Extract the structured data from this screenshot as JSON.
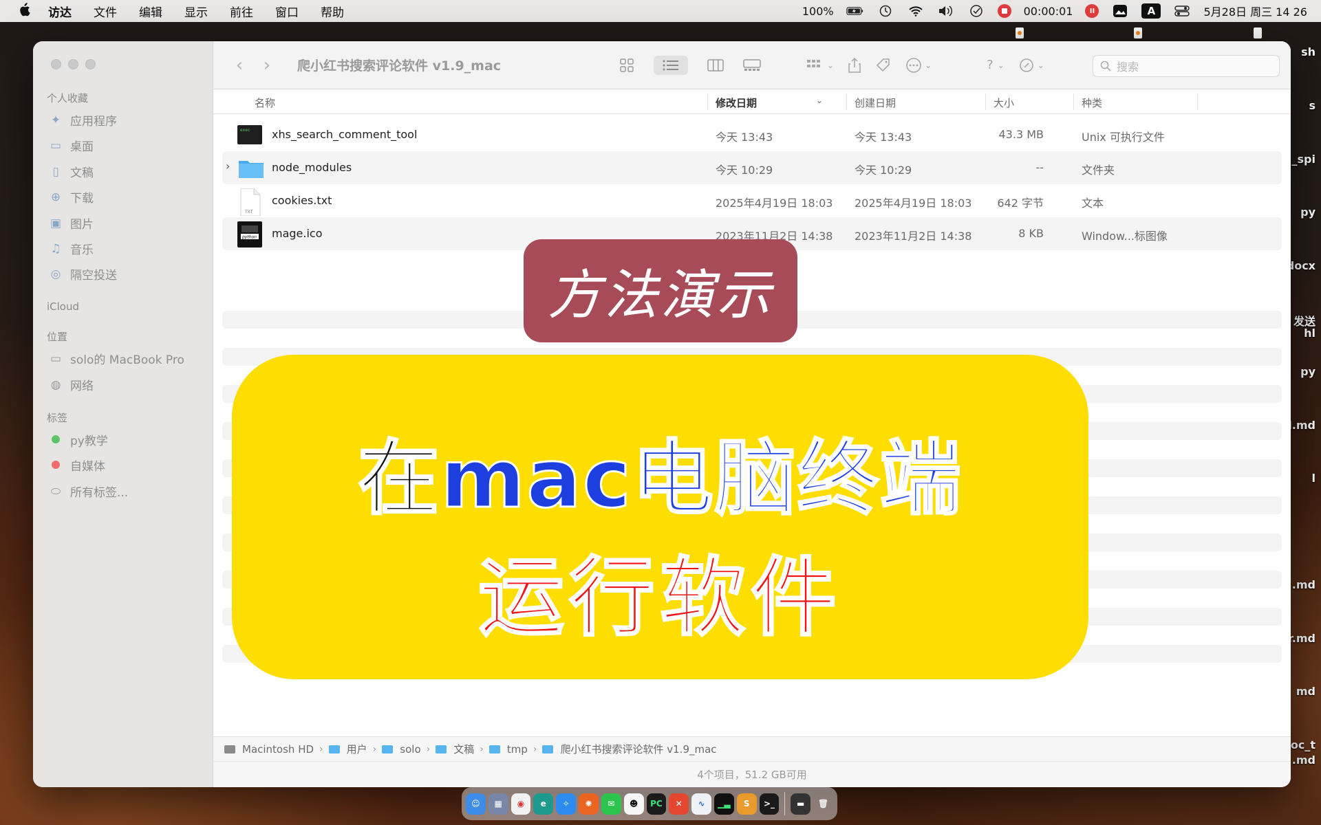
{
  "menubar": {
    "app_name": "访达",
    "items": [
      "文件",
      "编辑",
      "显示",
      "前往",
      "窗口",
      "帮助"
    ],
    "battery": "100%",
    "timer": "00:00:01",
    "input_badge": "A",
    "datetime": "5月28日 周三  14 26"
  },
  "desktop_labels": [
    "sh",
    "s",
    "_spi",
    "py",
    "docx",
    "发送",
    "hl",
    "py",
    "l.md",
    "l",
    ".md",
    "r.md",
    "md",
    "oc_t",
    ".md"
  ],
  "window": {
    "title": "爬小红书搜索评论软件 v1.9_mac",
    "search_placeholder": "搜索"
  },
  "sidebar": {
    "favorites_title": "个人收藏",
    "favorites": [
      {
        "label": "应用程序",
        "icon": "apps-icon"
      },
      {
        "label": "桌面",
        "icon": "desktop-icon"
      },
      {
        "label": "文稿",
        "icon": "document-icon"
      },
      {
        "label": "下载",
        "icon": "download-icon"
      },
      {
        "label": "图片",
        "icon": "pictures-icon"
      },
      {
        "label": "音乐",
        "icon": "music-icon"
      },
      {
        "label": "隔空投送",
        "icon": "airdrop-icon"
      }
    ],
    "icloud_title": "iCloud",
    "locations_title": "位置",
    "locations": [
      {
        "label": "solo的 MacBook Pro",
        "icon": "laptop-icon"
      },
      {
        "label": "网络",
        "icon": "network-icon"
      }
    ],
    "tags_title": "标签",
    "tags": [
      {
        "label": "py教学",
        "color": "#5cc46a"
      },
      {
        "label": "自媒体",
        "color": "#f26a6a"
      },
      {
        "label": "所有标签...",
        "color": ""
      }
    ]
  },
  "columns": {
    "name": "名称",
    "modified": "修改日期",
    "created": "创建日期",
    "size": "大小",
    "kind": "种类"
  },
  "files": [
    {
      "name": "xhs_search_comment_tool",
      "modified": "今天 13:43",
      "created": "今天 13:43",
      "size": "43.3 MB",
      "kind": "Unix 可执行文件",
      "icon": "terminal-exec-icon"
    },
    {
      "name": "node_modules",
      "modified": "今天 10:29",
      "created": "今天 10:29",
      "size": "--",
      "kind": "文件夹",
      "icon": "folder-icon"
    },
    {
      "name": "cookies.txt",
      "modified": "2025年4月19日 18:03",
      "created": "2025年4月19日 18:03",
      "size": "642 字节",
      "kind": "文本",
      "icon": "text-file-icon"
    },
    {
      "name": "mage.ico",
      "modified": "2023年11月2日 14:38",
      "created": "2023年11月2日 14:38",
      "size": "8 KB",
      "kind": "Window...标图像",
      "icon": "ico-image-icon"
    }
  ],
  "pathbar": [
    "Macintosh HD",
    "用户",
    "solo",
    "文稿",
    "tmp",
    "爬小红书搜索评论软件 v1.9_mac"
  ],
  "status": "4个项目，51.2 GB可用",
  "overlay": {
    "badge": "方法演示",
    "line1_a": "在",
    "line1_b": "mac电脑终端",
    "line2": "运行软件"
  },
  "colors": {
    "badge_bg": "#a84b58",
    "card_bg": "#fedd00",
    "blue_text": "#1d3fe0",
    "red_text": "#f01414"
  }
}
